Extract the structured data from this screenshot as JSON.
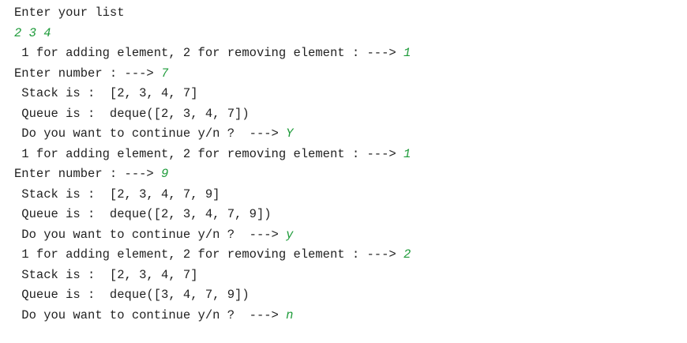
{
  "console": {
    "lines": [
      {
        "prompt": "Enter your list",
        "input": ""
      },
      {
        "prompt": "",
        "input": "2 3 4"
      },
      {
        "prompt": " 1 for adding element, 2 for removing element : ---> ",
        "input": "1"
      },
      {
        "prompt": "Enter number : ---> ",
        "input": "7"
      },
      {
        "prompt": " Stack is :  [2, 3, 4, 7]",
        "input": ""
      },
      {
        "prompt": " Queue is :  deque([2, 3, 4, 7])",
        "input": ""
      },
      {
        "prompt": " Do you want to continue y/n ?  ---> ",
        "input": "Y"
      },
      {
        "prompt": " 1 for adding element, 2 for removing element : ---> ",
        "input": "1"
      },
      {
        "prompt": "Enter number : ---> ",
        "input": "9"
      },
      {
        "prompt": " Stack is :  [2, 3, 4, 7, 9]",
        "input": ""
      },
      {
        "prompt": " Queue is :  deque([2, 3, 4, 7, 9])",
        "input": ""
      },
      {
        "prompt": " Do you want to continue y/n ?  ---> ",
        "input": "y"
      },
      {
        "prompt": " 1 for adding element, 2 for removing element : ---> ",
        "input": "2"
      },
      {
        "prompt": " Stack is :  [2, 3, 4, 7]",
        "input": ""
      },
      {
        "prompt": " Queue is :  deque([3, 4, 7, 9])",
        "input": ""
      },
      {
        "prompt": " Do you want to continue y/n ?  ---> ",
        "input": "n"
      }
    ]
  },
  "colors": {
    "text": "#222222",
    "user_input": "#1e9b3a",
    "background": "#ffffff"
  }
}
